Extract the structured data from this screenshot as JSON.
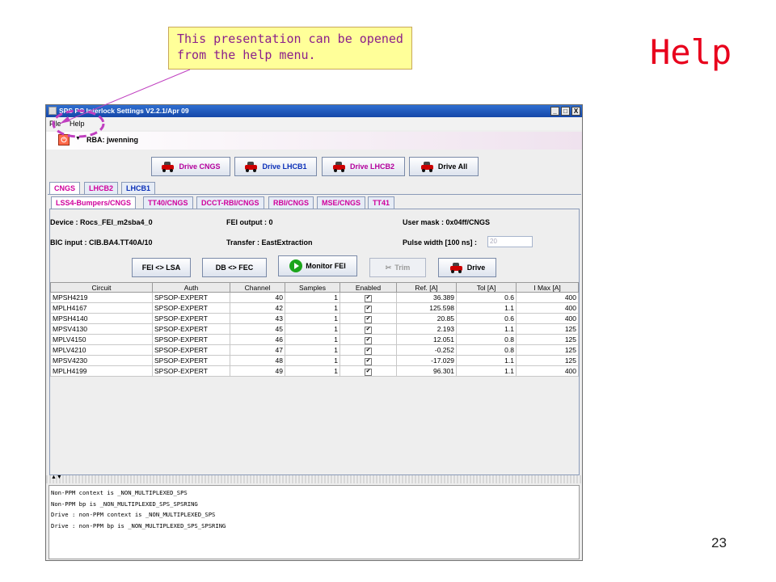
{
  "slide": {
    "title": "Help",
    "page_number": "23",
    "callout_lines": [
      "This presentation can be opened",
      "from the help menu."
    ]
  },
  "window": {
    "title": "SPS PC Interlock Settings V2.2.1/Apr  09",
    "controls": {
      "minimize": "_",
      "maximize": "□",
      "close": "X"
    }
  },
  "menu": {
    "items": [
      "File",
      "Help"
    ]
  },
  "toolbar": {
    "rba_label": "RBA: jwenning"
  },
  "drive_buttons": [
    {
      "label": "Drive CNGS"
    },
    {
      "label": "Drive LHCB1"
    },
    {
      "label": "Drive LHCB2"
    },
    {
      "label": "Drive All"
    }
  ],
  "beam_tabs": [
    {
      "label": "CNGS",
      "active": true
    },
    {
      "label": "LHCB2",
      "active": false
    },
    {
      "label": "LHCB1",
      "active": false
    }
  ],
  "sub_tabs": [
    {
      "label": "LSS4-Bumpers/CNGS",
      "active": true
    },
    {
      "label": "TT40/CNGS",
      "active": false
    },
    {
      "label": "DCCT-RBI/CNGS",
      "active": false
    },
    {
      "label": "RBI/CNGS",
      "active": false
    },
    {
      "label": "MSE/CNGS",
      "active": false
    },
    {
      "label": "TT41",
      "active": false
    }
  ],
  "info": {
    "device": "Device : Rocs_FEI_m2sba4_0",
    "fei_output": "FEI output : 0",
    "user_mask": "User mask : 0x04ff/CNGS",
    "bic_input": "BIC input : CIB.BA4.TT40A/10",
    "transfer": "Transfer : EastExtraction",
    "pulse_width_label": "Pulse width [100 ns] :",
    "pulse_width_value": "20"
  },
  "actions": {
    "fei_lsa": "FEI <> LSA",
    "db_fec": "DB <> FEC",
    "monitor_fei": "Monitor FEI",
    "trim": "Trim",
    "drive": "Drive"
  },
  "table": {
    "columns": [
      "Circuit",
      "Auth",
      "Channel",
      "Samples",
      "Enabled",
      "Ref. [A]",
      "Tol [A]",
      "I Max [A]"
    ],
    "rows": [
      [
        "MPSH4219",
        "SPSOP-EXPERT",
        "40",
        "1",
        "✔",
        "36.389",
        "0.6",
        "400"
      ],
      [
        "MPLH4167",
        "SPSOP-EXPERT",
        "42",
        "1",
        "✔",
        "125.598",
        "1.1",
        "400"
      ],
      [
        "MPSH4140",
        "SPSOP-EXPERT",
        "43",
        "1",
        "✔",
        "20.85",
        "0.6",
        "400"
      ],
      [
        "MPSV4130",
        "SPSOP-EXPERT",
        "45",
        "1",
        "✔",
        "2.193",
        "1.1",
        "125"
      ],
      [
        "MPLV4150",
        "SPSOP-EXPERT",
        "46",
        "1",
        "✔",
        "12.051",
        "0.8",
        "125"
      ],
      [
        "MPLV4210",
        "SPSOP-EXPERT",
        "47",
        "1",
        "✔",
        "-0.252",
        "0.8",
        "125"
      ],
      [
        "MPSV4230",
        "SPSOP-EXPERT",
        "48",
        "1",
        "✔",
        "-17.029",
        "1.1",
        "125"
      ],
      [
        "MPLH4199",
        "SPSOP-EXPERT",
        "49",
        "1",
        "✔",
        "96.301",
        "1.1",
        "400"
      ]
    ]
  },
  "console": {
    "lines": [
      "Non-PPM context is _NON_MULTIPLEXED_SPS",
      "Non-PPM bp is _NON_MULTIPLEXED_SPS_SPSRING",
      "Drive : non-PPM context is _NON_MULTIPLEXED_SPS",
      "Drive : non-PPM bp is _NON_MULTIPLEXED_SPS_SPSRING"
    ]
  },
  "colors": {
    "callout_bg": "#ffff99",
    "callout_text": "#8b1f8b",
    "title_red": "#e8001c",
    "annotation_purple": "#c040c0",
    "tab_magenta": "#d0009c",
    "tab_blue": "#0a2fb8"
  },
  "icons": [
    "drive-car-icon",
    "monitor-go-icon",
    "scissors-icon",
    "rba-icon",
    "window-icon"
  ]
}
